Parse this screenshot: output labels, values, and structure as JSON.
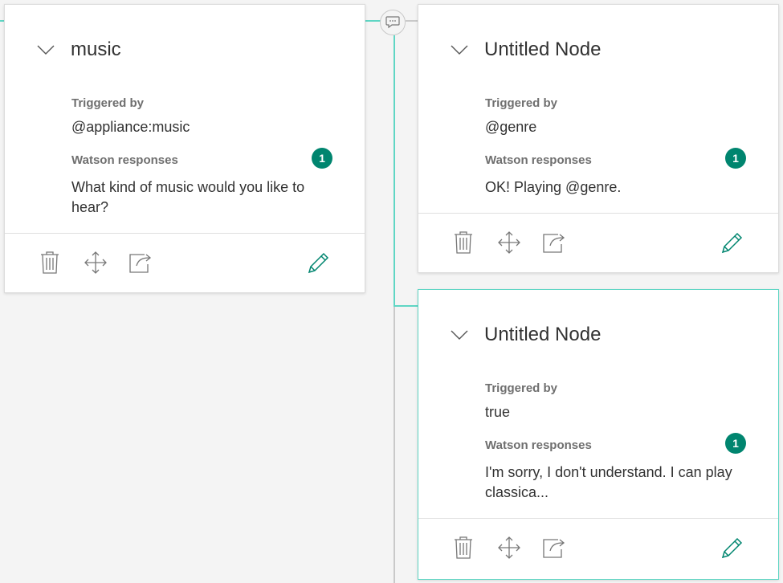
{
  "nodes": [
    {
      "title": "music",
      "triggered_label": "Triggered by",
      "trigger": "@appliance:music",
      "responses_label": "Watson responses",
      "response_count": "1",
      "response": "What kind of music would you like to hear?"
    },
    {
      "title": "Untitled Node",
      "triggered_label": "Triggered by",
      "trigger": "@genre",
      "responses_label": "Watson responses",
      "response_count": "1",
      "response": "OK! Playing @genre."
    },
    {
      "title": "Untitled Node",
      "triggered_label": "Triggered by",
      "trigger": "true",
      "responses_label": "Watson responses",
      "response_count": "1",
      "response": "I'm sorry, I don't understand. I can play classica..."
    }
  ],
  "icons": {
    "delete": "trash-icon",
    "move": "move-icon",
    "jump": "jump-to-icon",
    "edit": "pencil-icon",
    "collapse": "chevron-down-icon",
    "chat": "chat-bubble-icon"
  },
  "colors": {
    "accent": "#00856f",
    "connector": "#5fd6c4",
    "background": "#f4f4f4"
  }
}
